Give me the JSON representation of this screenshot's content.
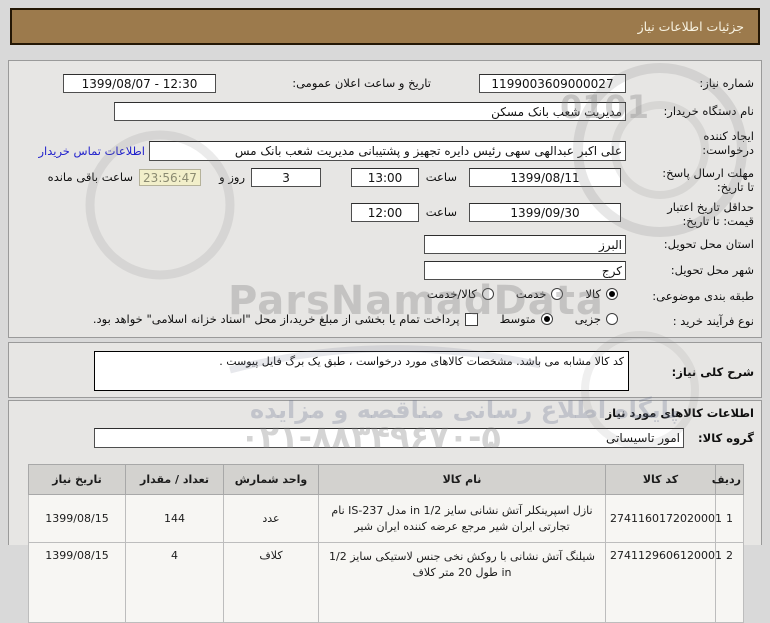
{
  "title_bar": {
    "title": "جزئیات اطلاعات نیاز"
  },
  "form": {
    "need_number": {
      "label": "شماره نیاز:",
      "value": "1199003609000027"
    },
    "announce": {
      "label": "تاریخ و ساعت اعلان عمومی:",
      "value": "1399/08/07 - 12:30"
    },
    "buyer_org": {
      "label": "نام دستگاه خریدار:",
      "value": "مدیریت شعب بانک مسکن"
    },
    "creator": {
      "label_line1": "ایجاد کننده",
      "label_line2": "درخواست:",
      "value": "علی اکبر عبدالهی سهی رئیس دایره تجهیز و پشتیبانی مدیریت شعب بانک مس",
      "contact_link": "اطلاعات تماس خریدار"
    },
    "deadline": {
      "label_line1": "مهلت ارسال پاسخ:",
      "label_line2": "تا تاریخ:",
      "date": "1399/08/11",
      "hour_label": "ساعت",
      "time": "13:00",
      "days_value": "3",
      "days_label": "روز و",
      "countdown": "23:56:47",
      "remaining_label": "ساعت باقی مانده"
    },
    "price_validity": {
      "label_line1": "حداقل تاریخ اعتبار",
      "label_line2": "قیمت: تا تاریخ:",
      "date": "1399/09/30",
      "hour_label": "ساعت",
      "time": "12:00"
    },
    "province": {
      "label": "استان محل تحویل:",
      "value": "البرز"
    },
    "city": {
      "label": "شهر محل تحویل:",
      "value": "کرج"
    },
    "classification": {
      "label": "طبقه بندی موضوعی:",
      "options": [
        {
          "label": "کالا",
          "selected": true
        },
        {
          "label": "خدمت",
          "selected": false
        },
        {
          "label": "کالا/خدمت",
          "selected": false
        }
      ]
    },
    "process_type": {
      "label": "نوع فرآیند خرید :",
      "options": [
        {
          "label": "جزیی",
          "selected": false
        },
        {
          "label": "متوسط",
          "selected": true
        }
      ],
      "treasury": {
        "checked": false,
        "label": "پرداخت تمام یا بخشی از مبلغ خرید،از محل \"اسناد خزانه اسلامی\" خواهد بود."
      }
    }
  },
  "description": {
    "label": "شرح کلی نیاز:",
    "value": "کد کالا مشابه می باشد. مشخصات کالاهای مورد درخواست ، طبق یک برگ فایل پیوست ."
  },
  "items_section": {
    "header": "اطلاعات کالاهای مورد نیاز",
    "group": {
      "label": "گروه کالا:",
      "value": "امور تاسیساتی"
    },
    "table": {
      "headers": [
        "ردیف",
        "کد کالا",
        "نام کالا",
        "واحد شمارش",
        "تعداد / مقدار",
        "تاریخ نیاز"
      ],
      "rows": [
        {
          "row": "1",
          "code": "2741160172020001",
          "name": "نازل اسپرینکلر آتش نشانی سایز 1/2 in مدل IS-237 نام تجارتی ایران شیر مرجع عرضه کننده ایران شیر",
          "unit": "عدد",
          "qty": "144",
          "date": "1399/08/15"
        },
        {
          "row": "2",
          "code": "2741129606120001",
          "name": "شیلنگ آتش نشانی با روکش نخی جنس لاستیکی سایز 1/2 in طول 20 متر کلاف",
          "unit": "کلاف",
          "qty": "4",
          "date": "1399/08/15"
        }
      ]
    }
  },
  "watermark": {
    "brand": "ParsNamadData",
    "digits": "0101",
    "line": "پایگاه اطلاع رسانی مناقصه و مزایده",
    "phone": "۰۲۱-۸۸۳۴۹۶۷۰-۵"
  },
  "colors": {
    "title_bar_bg": "#9c7a4c",
    "link": "#2323cc",
    "countdown_bg": "#f2efca",
    "table_header_bg": "#d3d2cf"
  }
}
